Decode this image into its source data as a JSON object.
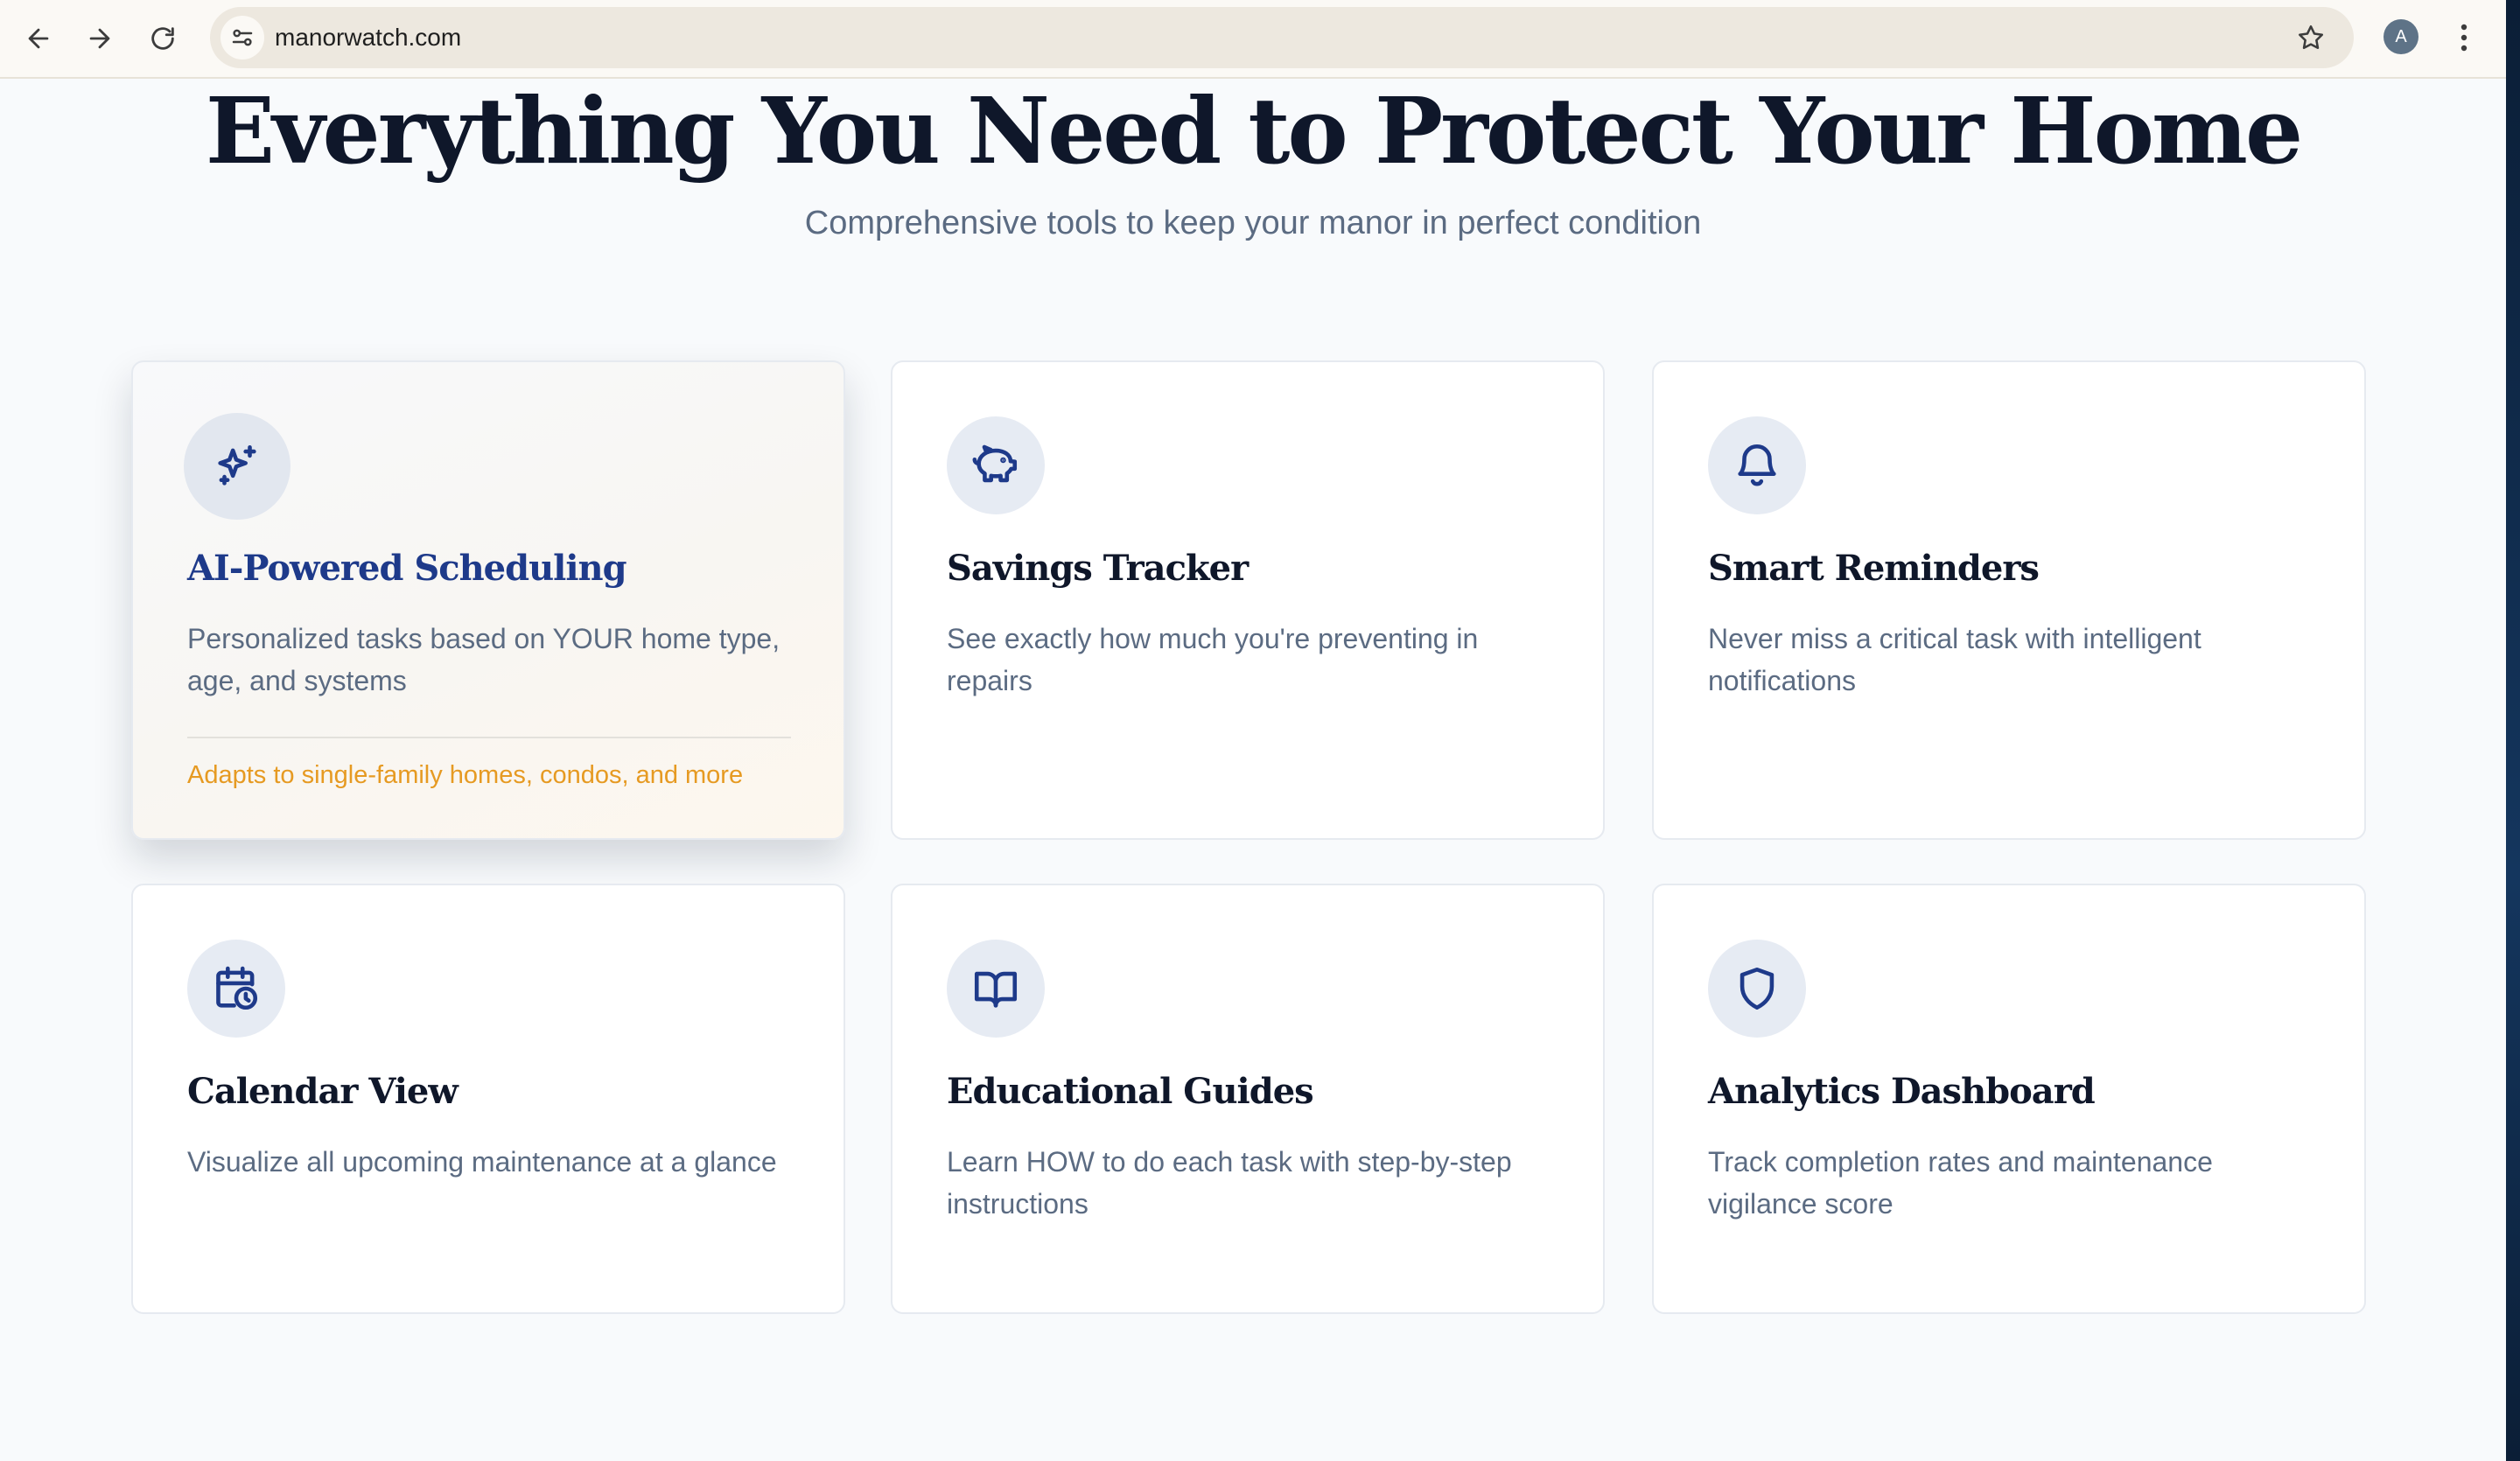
{
  "browser": {
    "url": "manorwatch.com",
    "profile_initial": "A",
    "icons": {
      "back": "arrow-left-icon",
      "forward": "arrow-right-icon",
      "reload": "reload-icon",
      "site_info": "tune-icon",
      "bookmark": "star-icon",
      "menu": "more-vert-icon"
    }
  },
  "hero": {
    "title": "Everything You Need to Protect Your Home",
    "subtitle": "Comprehensive tools to keep your manor in perfect condition"
  },
  "features": [
    {
      "icon": "sparkles-icon",
      "title": "AI-Powered Scheduling",
      "description": "Personalized tasks based on YOUR home type, age, and systems",
      "note": "Adapts to single-family homes, condos, and more",
      "highlighted": true
    },
    {
      "icon": "piggy-bank-icon",
      "title": "Savings Tracker",
      "description": "See exactly how much you're preventing in repairs"
    },
    {
      "icon": "bell-icon",
      "title": "Smart Reminders",
      "description": "Never miss a critical task with intelligent notifications"
    },
    {
      "icon": "calendar-clock-icon",
      "title": "Calendar View",
      "description": "Visualize all upcoming maintenance at a glance"
    },
    {
      "icon": "book-open-icon",
      "title": "Educational Guides",
      "description": "Learn HOW to do each task with step-by-step instructions"
    },
    {
      "icon": "shield-icon",
      "title": "Analytics Dashboard",
      "description": "Track completion rates and maintenance vigilance score"
    }
  ],
  "colors": {
    "heading": "#0f172a",
    "accent_blue": "#1e3a8a",
    "accent_orange": "#e69a22",
    "muted_text": "#5b6b82",
    "icon_bg": "#e6ebf3",
    "page_bg": "#f8fafc"
  }
}
